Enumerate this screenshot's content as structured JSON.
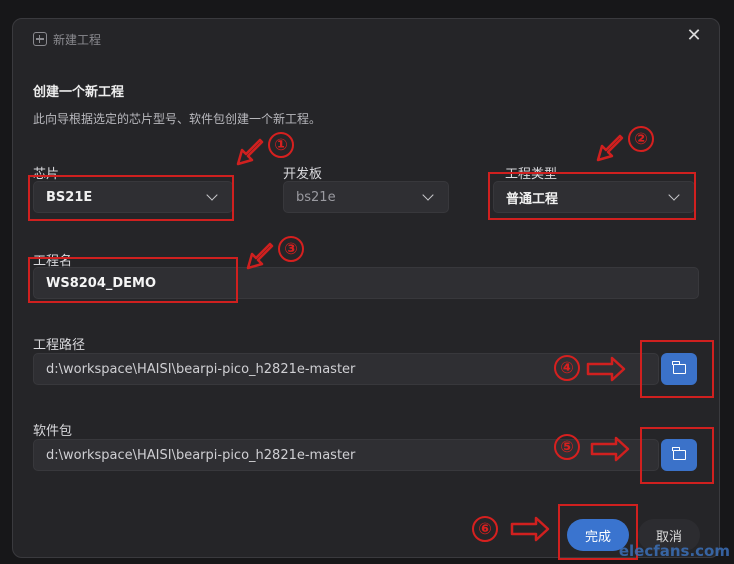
{
  "dialog": {
    "title": "新建工程",
    "title_icon": "new-project-icon",
    "close_icon": "close-icon",
    "heading": "创建一个新工程",
    "description": "此向导根据选定的芯片型号、软件包创建一个新工程。"
  },
  "fields": {
    "chip": {
      "label": "芯片",
      "value": "BS21E"
    },
    "board": {
      "label": "开发板",
      "value": "bs21e"
    },
    "project_type": {
      "label": "工程类型",
      "value": "普通工程"
    },
    "project_name": {
      "label": "工程名",
      "value": "WS8204_DEMO"
    },
    "project_path": {
      "label": "工程路径",
      "value": "d:\\workspace\\HAISI\\bearpi-pico_h2821e-master",
      "browse_icon": "folder-open-icon"
    },
    "package": {
      "label": "软件包",
      "value": "d:\\workspace\\HAISI\\bearpi-pico_h2821e-master",
      "browse_icon": "folder-open-icon"
    }
  },
  "buttons": {
    "done": "完成",
    "cancel": "取消"
  },
  "annotations": {
    "markers": [
      "①",
      "②",
      "③",
      "④",
      "⑤",
      "⑥"
    ],
    "color": "#d0201f"
  },
  "watermark": "elecfans.com"
}
